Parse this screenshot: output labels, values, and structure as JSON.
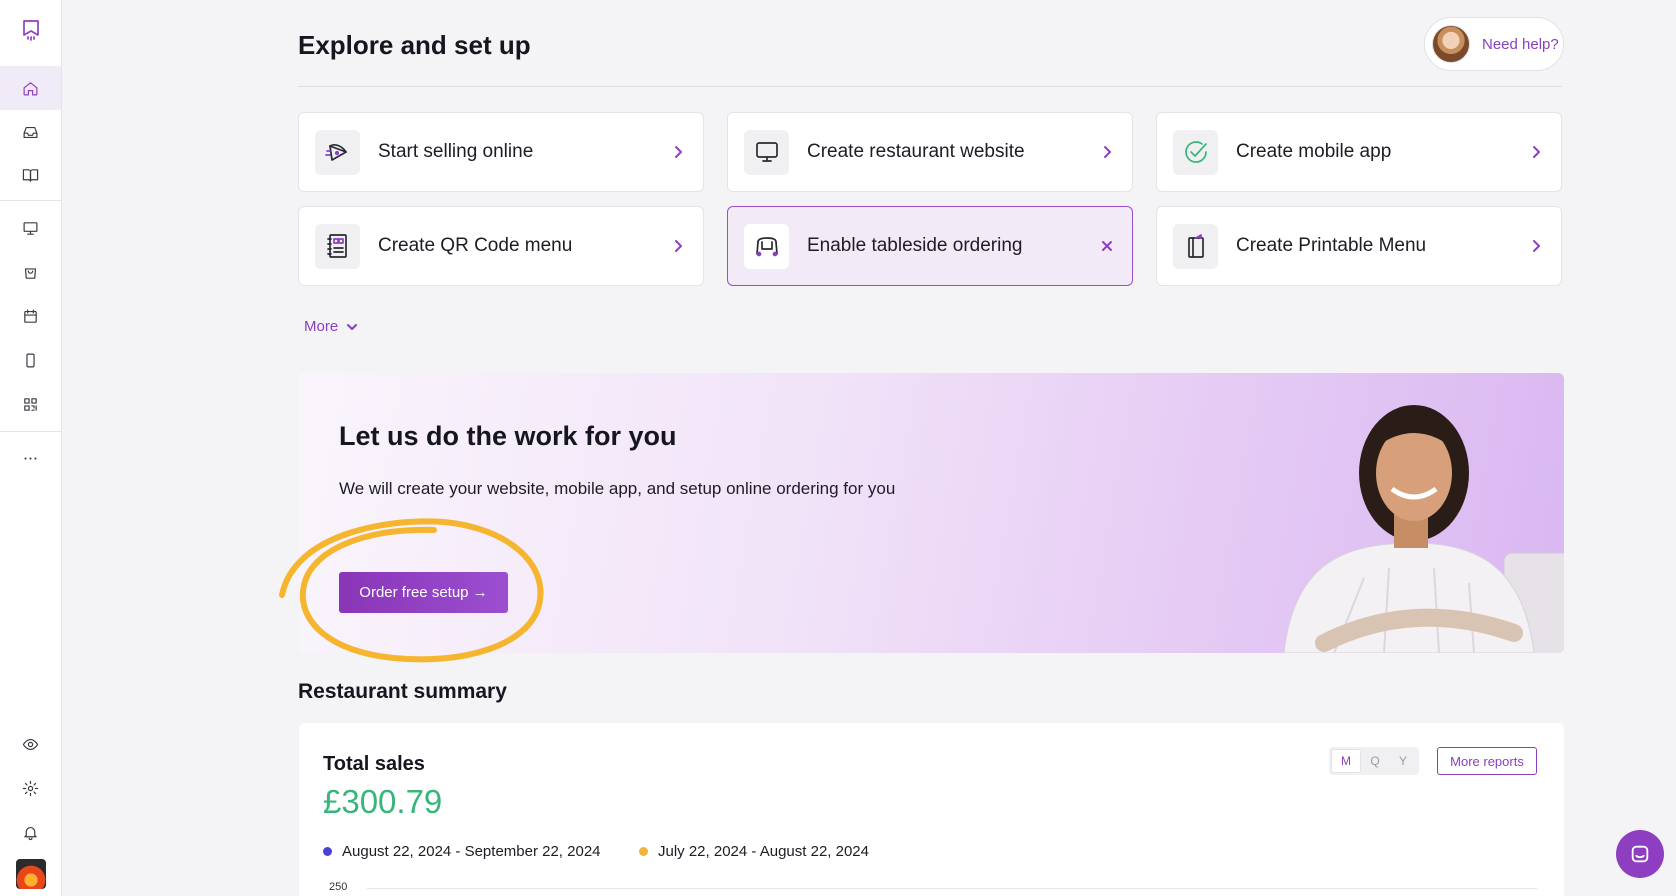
{
  "page": {
    "title": "Explore and set up",
    "help_label": "Need help?"
  },
  "sidebar": {
    "top_items": [
      {
        "icon": "logo-icon"
      },
      {
        "icon": "home-icon",
        "active": true
      },
      {
        "icon": "inbox-icon"
      },
      {
        "icon": "book-icon"
      }
    ],
    "mid_items": [
      {
        "icon": "monitor-icon"
      },
      {
        "icon": "shopping-bag-icon"
      },
      {
        "icon": "calendar-icon"
      },
      {
        "icon": "mobile-icon"
      },
      {
        "icon": "qr-code-icon"
      }
    ],
    "more_icon": "more-dots-icon",
    "bottom_items": [
      {
        "icon": "eye-icon"
      },
      {
        "icon": "gear-icon"
      },
      {
        "icon": "bell-icon"
      },
      {
        "icon": "restaurant-logo-icon"
      }
    ]
  },
  "cards": [
    {
      "label": "Start selling online",
      "icon": "pizza-slice-icon",
      "action": "chevron"
    },
    {
      "label": "Create restaurant website",
      "icon": "monitor-icon",
      "action": "chevron"
    },
    {
      "label": "Create mobile app",
      "icon": "check-circle-icon",
      "action": "chevron"
    },
    {
      "label": "Create QR Code menu",
      "icon": "qr-menu-icon",
      "action": "chevron"
    },
    {
      "label": "Enable tableside ordering",
      "icon": "table-icon",
      "action": "close",
      "highlighted": true
    },
    {
      "label": "Create Printable Menu",
      "icon": "printable-menu-icon",
      "action": "chevron"
    }
  ],
  "more_label": "More",
  "promo": {
    "title": "Let us do the work for you",
    "text": "We will create your website, mobile app, and setup online ordering for you",
    "button_label": "Order free setup →"
  },
  "summary": {
    "title": "Restaurant summary",
    "card_title": "Total sales",
    "value": "£300.79",
    "legend": [
      {
        "label": "August 22, 2024 - September 22, 2024",
        "color": "#4a3fd6"
      },
      {
        "label": "July 22, 2024 - August 22, 2024",
        "color": "#f0b43a"
      }
    ],
    "periods": [
      "M",
      "Q",
      "Y"
    ],
    "active_period": "M",
    "more_reports_label": "More reports",
    "axis_top_label": "250"
  },
  "colors": {
    "accent": "#8e3fc1",
    "positive": "#38b67a",
    "highlight": "#f0b43a"
  }
}
